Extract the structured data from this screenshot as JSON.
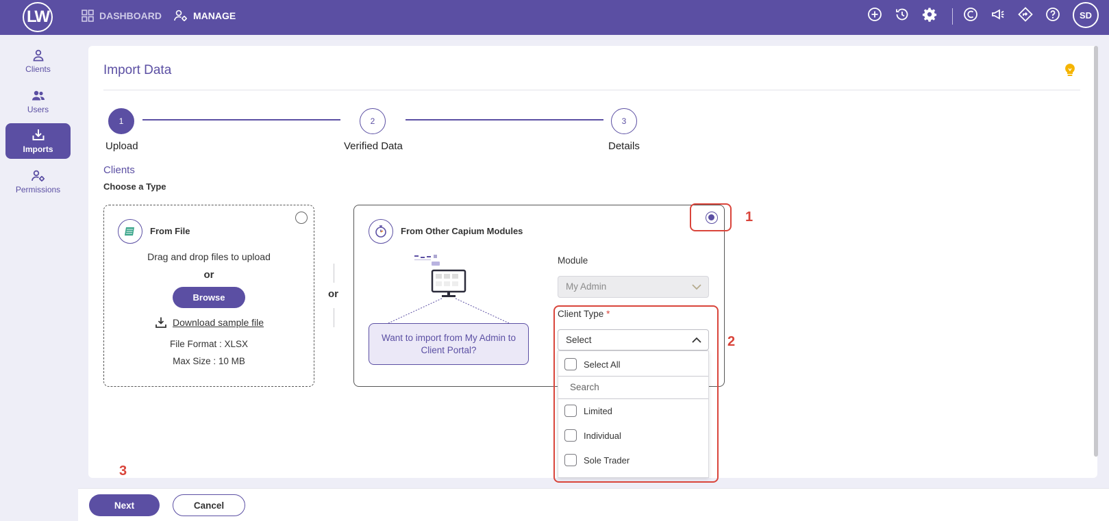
{
  "topbar": {
    "logo": "LW",
    "nav": [
      {
        "label": "DASHBOARD",
        "icon": "grid-icon"
      },
      {
        "label": "MANAGE",
        "icon": "user-gear-icon"
      }
    ],
    "icons": [
      "add-circle-icon",
      "history-icon",
      "settings-icon",
      "capium-icon",
      "announcement-icon",
      "directions-icon",
      "help-icon"
    ],
    "avatar": "SD"
  },
  "sidebar": {
    "items": [
      {
        "label": "Clients",
        "icon": "person-icon",
        "active": false
      },
      {
        "label": "Users",
        "icon": "users-icon",
        "active": false
      },
      {
        "label": "Imports",
        "icon": "import-icon",
        "active": true
      },
      {
        "label": "Permissions",
        "icon": "user-key-icon",
        "active": false
      }
    ]
  },
  "page": {
    "title": "Import Data",
    "steps": [
      {
        "number": "1",
        "label": "Upload",
        "active": true
      },
      {
        "number": "2",
        "label": "Verified Data",
        "active": false
      },
      {
        "number": "3",
        "label": "Details",
        "active": false
      }
    ],
    "section_title": "Clients",
    "section_subtitle": "Choose a Type"
  },
  "from_file": {
    "title": "From File",
    "drag_text": "Drag and drop files to upload",
    "or": "or",
    "browse": "Browse",
    "download_link": "Download sample file",
    "file_format": "File Format : XLSX",
    "max_size": "Max Size : 10 MB",
    "selected": false
  },
  "divider_or": "or",
  "from_modules": {
    "title": "From Other Capium Modules",
    "info": "Want to import from My Admin to Client Portal?",
    "module_label": "Module",
    "module_value": "My Admin",
    "client_type_label": "Client Type",
    "client_type_required": "*",
    "client_type_value": "Select",
    "selected": true,
    "dropdown": {
      "select_all": "Select All",
      "search_placeholder": "Search",
      "options": [
        "Limited",
        "Individual",
        "Sole Trader"
      ]
    }
  },
  "annotations": [
    "1",
    "2",
    "3"
  ],
  "footer": {
    "next": "Next",
    "cancel": "Cancel"
  },
  "colors": {
    "primary": "#5b4fa3",
    "annotation": "#d9443a",
    "background": "#eeeef7",
    "bulb": "#f5b400"
  }
}
